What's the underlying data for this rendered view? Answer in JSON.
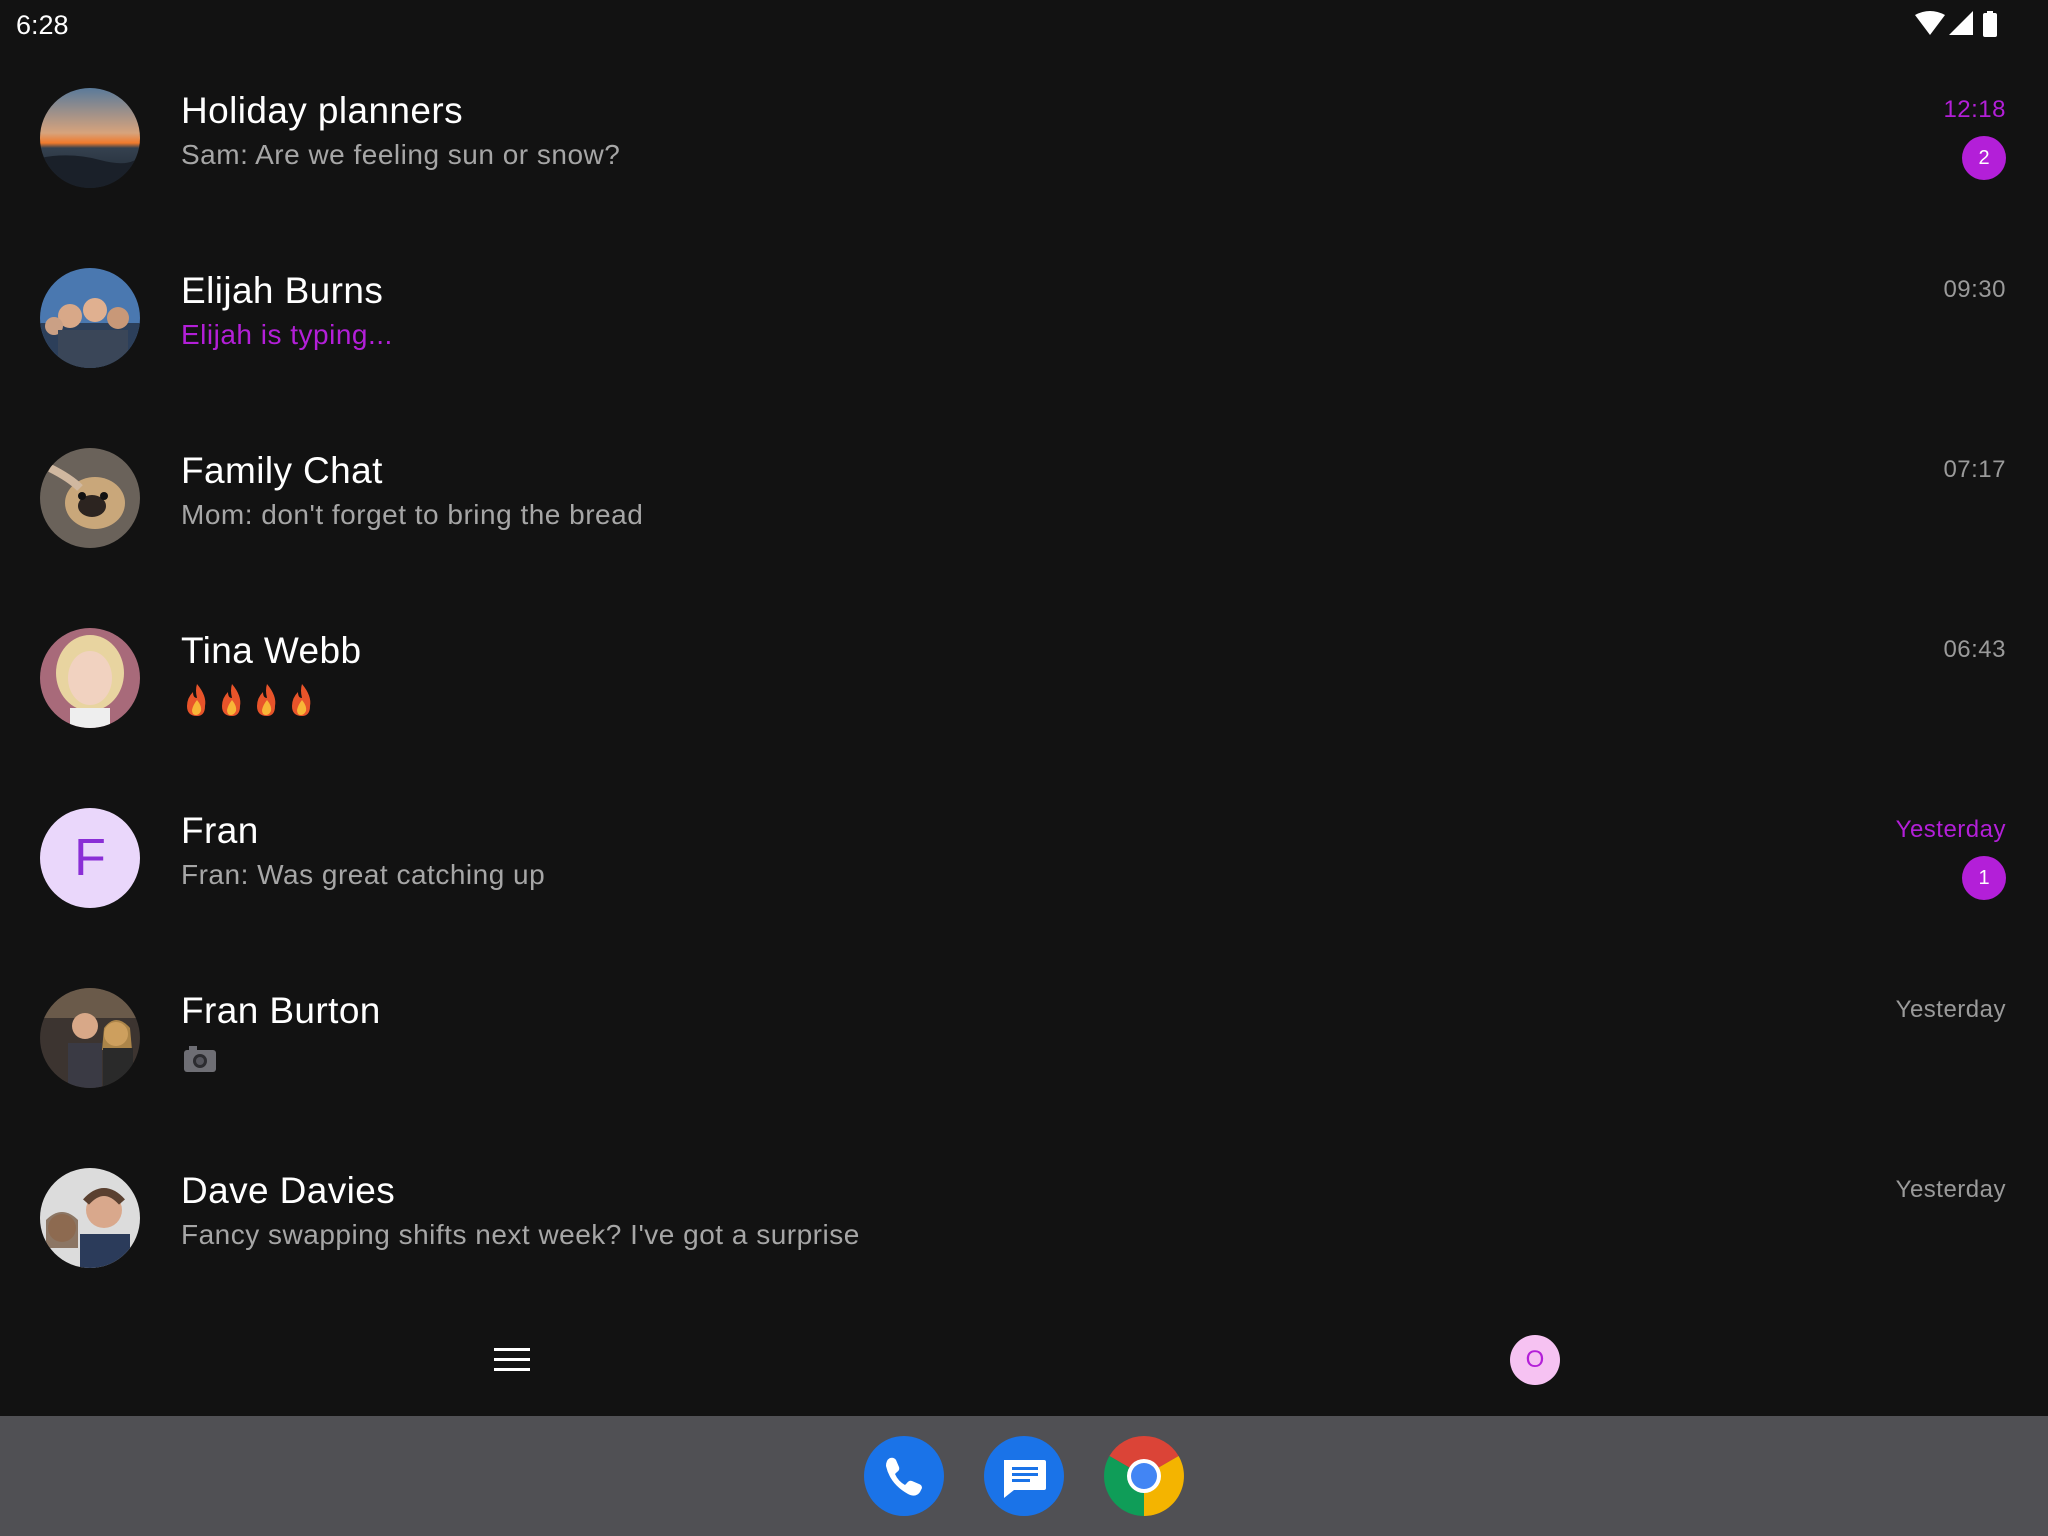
{
  "status_bar": {
    "time": "6:28",
    "icons": [
      "wifi-icon",
      "signal-icon",
      "battery-icon"
    ]
  },
  "conversations": [
    {
      "name": "Holiday planners",
      "preview": "Sam: Are we feeling sun or snow?",
      "time": "12:18",
      "unread": "2",
      "avatar": "sunset-photo"
    },
    {
      "name": "Elijah Burns",
      "preview": "Elijah is typing...",
      "time": "09:30",
      "avatar": "group-selfie-photo"
    },
    {
      "name": "Family Chat",
      "preview": "Mom: don't forget to bring the bread",
      "time": "07:17",
      "avatar": "pug-dog-photo"
    },
    {
      "name": "Tina Webb",
      "preview_icons": [
        "fire-emoji",
        "fire-emoji",
        "fire-emoji",
        "fire-emoji"
      ],
      "time": "06:43",
      "avatar": "woman-portrait-photo"
    },
    {
      "name": "Fran",
      "preview": "Fran: Was great catching up",
      "time": "Yesterday",
      "unread": "1",
      "avatar_letter": "F"
    },
    {
      "name": "Fran Burton",
      "preview_icons": [
        "camera-emoji"
      ],
      "time": "Yesterday",
      "avatar": "couple-photo"
    },
    {
      "name": "Dave Davies",
      "preview": "Fancy swapping shifts next week? I've got a surprise",
      "time": "Yesterday",
      "avatar": "couple-selfie-photo"
    }
  ],
  "bottom_bar": {
    "menu_icon": "hamburger-menu-icon",
    "profile_initial": "O"
  },
  "dock": {
    "apps": [
      "phone-app-icon",
      "messages-app-icon",
      "chrome-app-icon"
    ]
  },
  "colors": {
    "background": "#121212",
    "accent": "#b31fd8",
    "dock": "#505054"
  }
}
